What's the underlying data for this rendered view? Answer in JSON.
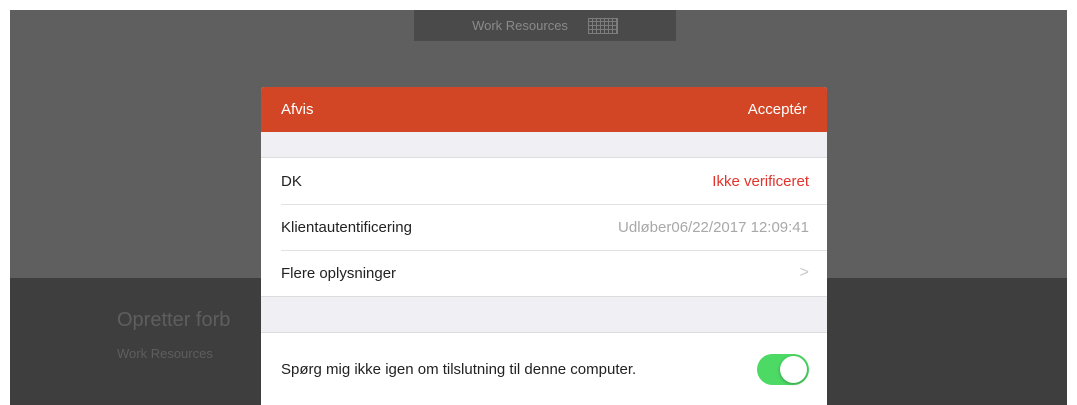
{
  "background": {
    "title": "Work Resources",
    "connecting_title": "Opretter forb",
    "connecting_subtitle": "Work Resources"
  },
  "icons": {
    "keyboard": "keyboard-icon",
    "chevron": "chevron-right-icon"
  },
  "dialog": {
    "reject_label": "Afvis",
    "accept_label": "Acceptér",
    "rows": [
      {
        "label": "DK",
        "value": "Ikke verificeret"
      },
      {
        "label": "Klientautentificering",
        "value": "Udløber06/22/2017 12:09:41"
      },
      {
        "label": "Flere oplysninger",
        "value": ">"
      }
    ],
    "toggle_label": "Spørg mig ikke igen om tilslutning til denne computer.",
    "toggle_on": true
  },
  "colors": {
    "header": "#d24625",
    "warning_text": "#e2322b",
    "toggle_on": "#4cd964"
  }
}
